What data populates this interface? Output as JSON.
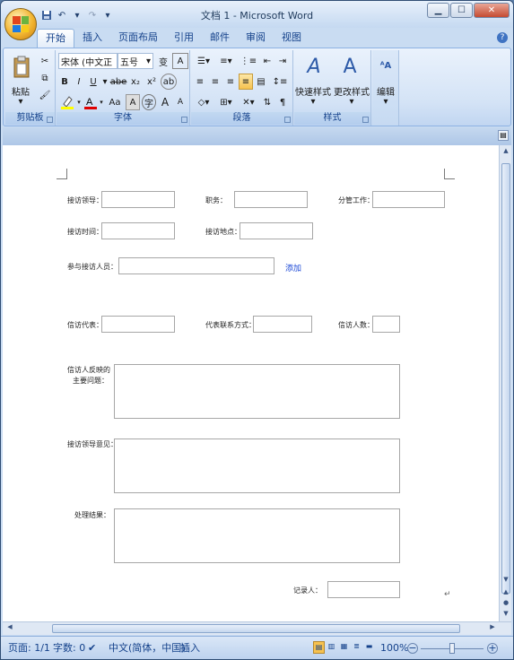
{
  "window": {
    "title": "文档 1 - Microsoft Word"
  },
  "quick_access": [
    "save-icon",
    "undo-icon",
    "redo-icon",
    "customize-icon"
  ],
  "tabs": [
    "开始",
    "插入",
    "页面布局",
    "引用",
    "邮件",
    "审阅",
    "视图"
  ],
  "ribbon": {
    "clipboard": {
      "paste": "粘贴",
      "label": "剪贴板"
    },
    "font": {
      "font_name": "宋体 (中文正文)",
      "font_name_short": "宋体 (中文正",
      "font_size": "五号",
      "label": "字体",
      "bold": "B",
      "italic": "I",
      "underline": "U",
      "strike": "abe",
      "sub": "x₂",
      "sup": "x²",
      "size_aa": "Aa",
      "grow": "A",
      "shrink": "A"
    },
    "paragraph": {
      "label": "段落"
    },
    "styles": {
      "quick": "快速样式",
      "change": "更改样式",
      "label": "样式"
    },
    "editing": {
      "label": "编辑"
    }
  },
  "form": {
    "host_leader": "接访领导：",
    "position": "职务：",
    "work_area": "分管工作：",
    "host_time": "接访时间：",
    "host_place": "接访地点：",
    "participants": "参与接访人员：",
    "add_link": "添加",
    "visitor_rep": "信访代表：",
    "rep_contact": "代表联系方式：",
    "visitor_count": "信访人数：",
    "issue_line1": "信访人反映的",
    "issue_line2": "主要问题：",
    "leader_opinion": "接访领导意见：",
    "result": "处理结果：",
    "recorder": "记录人："
  },
  "status": {
    "page": "页面: 1/1",
    "words": "字数: 0",
    "language": "中文(简体，中国)",
    "mode": "插入",
    "zoom": "100%"
  }
}
